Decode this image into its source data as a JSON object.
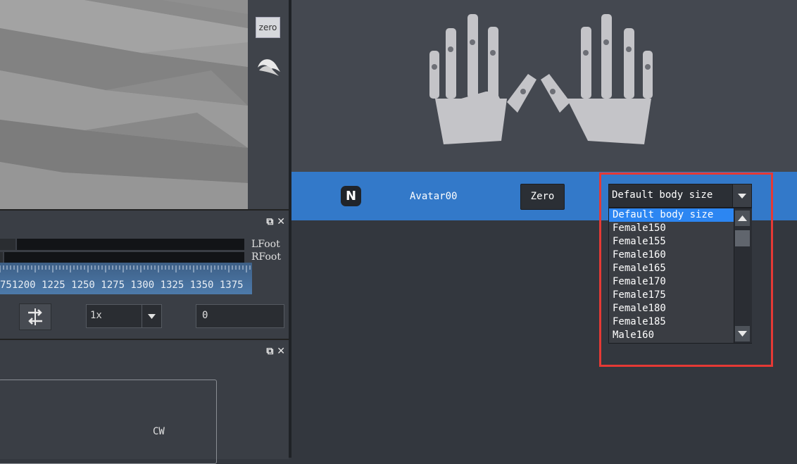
{
  "toolbar": {
    "zero_small_label": "zero",
    "mouse_icon": "mouse-icon"
  },
  "timeline": {
    "tracks": [
      {
        "label": "LFoot"
      },
      {
        "label": "RFoot"
      }
    ],
    "ruler_numbers": "751200 1225 1250 1275 1300 1325 1350 1375",
    "speed_value": "1x",
    "frame_value": "0"
  },
  "lower_panel": {
    "cw_label": "CW"
  },
  "avatar": {
    "badge": "N",
    "name": "Avatar00",
    "zero_label": "Zero",
    "body_size_selected": "Default body size",
    "body_size_options": [
      "Default body size",
      "Female150",
      "Female155",
      "Female160",
      "Female165",
      "Female170",
      "Female175",
      "Female180",
      "Female185",
      "Male160"
    ]
  },
  "colors": {
    "accent": "#3379c9",
    "selection": "#2c86f2",
    "highlight": "#e53935"
  }
}
